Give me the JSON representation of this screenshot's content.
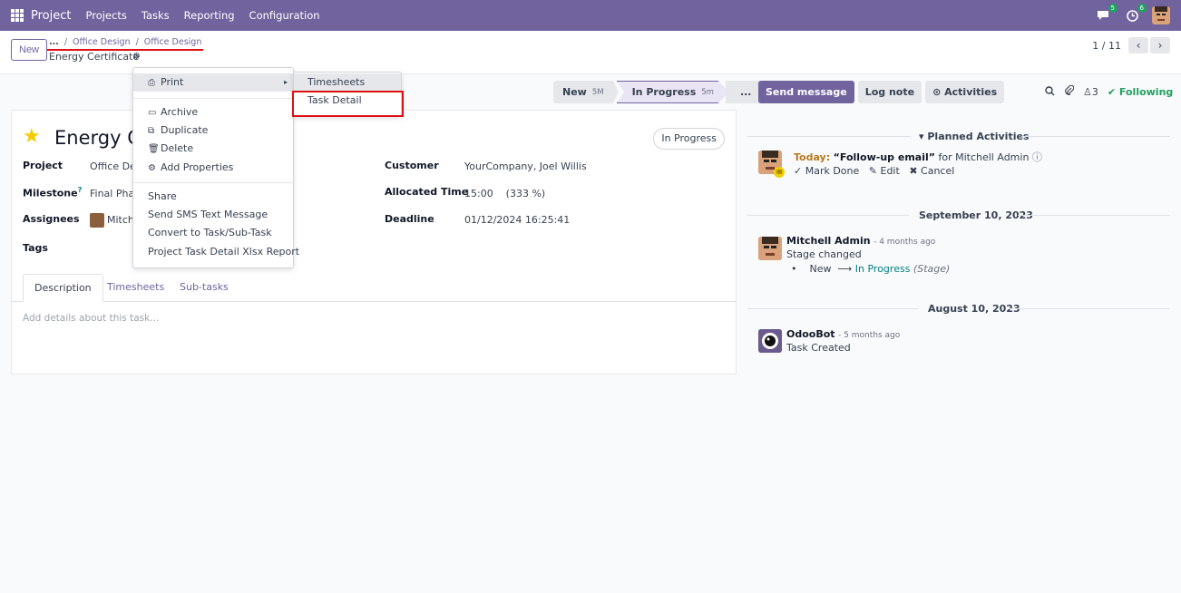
{
  "navbar": {
    "app_name": "Project",
    "menu": [
      "Projects",
      "Tasks",
      "Reporting",
      "Configuration"
    ],
    "messages_badge": "5",
    "activities_badge": "6"
  },
  "control": {
    "new_label": "New",
    "breadcrumb": [
      "...",
      "Office Design",
      "Office Design"
    ],
    "record_name": "Energy Certificate",
    "pager": "1 / 11"
  },
  "statusbar": {
    "stages": [
      {
        "label": "New",
        "duration": "5M"
      },
      {
        "label": "In Progress",
        "duration": "5m"
      },
      {
        "label": "..."
      }
    ]
  },
  "form": {
    "title": "Energy Certificate",
    "status": "In Progress",
    "left_fields": [
      {
        "label": "Project",
        "value": "Office Design"
      },
      {
        "label": "Milestone",
        "value": "Final Phase"
      },
      {
        "label": "Assignees",
        "value": "Mitchell Admin"
      },
      {
        "label": "Tags",
        "value": ""
      }
    ],
    "right_fields": [
      {
        "label": "Customer",
        "value": "YourCompany, Joel Willis"
      },
      {
        "label": "Allocated Time",
        "value": "15:00    (333 %)"
      },
      {
        "label": "Deadline",
        "value": "01/12/2024 16:25:41"
      }
    ],
    "tabs": [
      "Description",
      "Timesheets",
      "Sub-tasks"
    ],
    "description_placeholder": "Add details about this task..."
  },
  "action_menu": {
    "print": "Print",
    "group1": [
      "Archive",
      "Duplicate",
      "Delete",
      "Add Properties"
    ],
    "group2": [
      "Share",
      "Send SMS Text Message",
      "Convert to Task/Sub-Task",
      "Project Task Detail Xlsx Report"
    ],
    "submenu": [
      "Timesheets",
      "Task Detail"
    ]
  },
  "chatter": {
    "send_message": "Send message",
    "log_note": "Log note",
    "activities": "Activities",
    "attachment_count": "3",
    "following": "Following",
    "planned_heading": "Planned Activities",
    "activity": {
      "today": "Today:",
      "summary": "“Follow-up email”",
      "for": "for Mitchell Admin",
      "mark_done": "Mark Done",
      "edit": "Edit",
      "cancel": "Cancel"
    },
    "date1": "September 10, 2023",
    "msg1": {
      "author": "Mitchell Admin",
      "time": "- 4 months ago",
      "body": "Stage changed",
      "from": "New",
      "to": "In Progress",
      "field": "(Stage)"
    },
    "date2": "August 10, 2023",
    "msg2": {
      "author": "OdooBot",
      "time": "- 5 months ago",
      "body": "Task Created"
    }
  },
  "colors": {
    "brand": "#71639e",
    "success": "#20a160",
    "annotation_red": "#dd1111"
  }
}
